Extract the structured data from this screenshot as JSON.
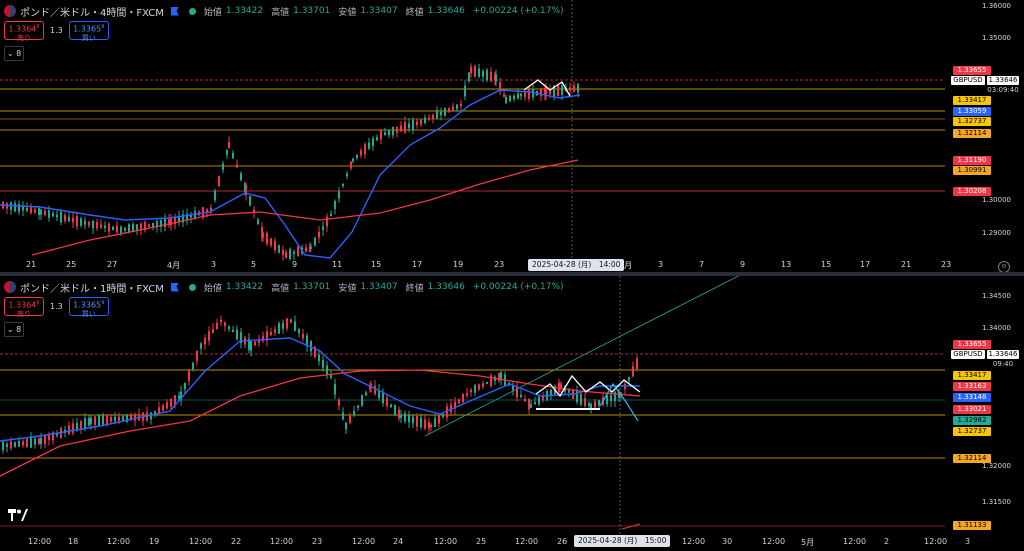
{
  "colors": {
    "bull": "#22ab94",
    "bear": "#f23645",
    "ma_blue": "#2962ff",
    "ma_red": "#f23645",
    "yellow": "#f7c600",
    "orange": "#f5a623"
  },
  "pane4h": {
    "title": "ポンド／米ドル・4時間・FXCM",
    "ohlc": [
      {
        "k": "始値",
        "v": "1.33422"
      },
      {
        "k": "高値",
        "v": "1.33701"
      },
      {
        "k": "安値",
        "v": "1.33407"
      },
      {
        "k": "終値",
        "v": "1.33646"
      },
      {
        "k": "",
        "v": "+0.00224 (+0.17%)"
      }
    ],
    "sell": {
      "price": "1.3364",
      "sup": "6",
      "label": "売り"
    },
    "buy": {
      "price": "1.3365",
      "sup": "9",
      "label": "買い"
    },
    "spread": "1.3",
    "collapse": "8",
    "axis_prices": [
      "1.36000",
      "1.35000",
      "1.30000",
      "1.29000"
    ],
    "labels": [
      "1.33655",
      "1.33417",
      "1.33059",
      "1.32737",
      "1.32114",
      "1.31190",
      "1.30991",
      "1.30208"
    ],
    "gbp": {
      "sym": "GBPUSD",
      "price": "1.33646",
      "countdown": "03:09:40"
    },
    "time_labels": [
      "21",
      "25",
      "27",
      "4月",
      "3",
      "5",
      "9",
      "11",
      "15",
      "17",
      "19",
      "23",
      "5月",
      "3",
      "7",
      "9",
      "13",
      "15",
      "17",
      "21",
      "23"
    ],
    "crosshair": "2025-04-28 (月)　14:00"
  },
  "pane1h": {
    "title": "ポンド／米ドル・1時間・FXCM",
    "ohlc": [
      {
        "k": "始値",
        "v": "1.33422"
      },
      {
        "k": "高値",
        "v": "1.33701"
      },
      {
        "k": "安値",
        "v": "1.33407"
      },
      {
        "k": "終値",
        "v": "1.33646"
      },
      {
        "k": "",
        "v": "+0.00224 (+0.17%)"
      }
    ],
    "sell": {
      "price": "1.3364",
      "sup": "6",
      "label": "売り"
    },
    "buy": {
      "price": "1.3365",
      "sup": "9",
      "label": "買い"
    },
    "spread": "1.3",
    "collapse": "8",
    "axis_prices": [
      "1.34500",
      "1.34000",
      "1.32000",
      "1.31500"
    ],
    "labels": [
      "1.33655",
      "1.33417",
      "1.33163",
      "1.33148",
      "1.33021",
      "1.32982",
      "1.32737",
      "1.32114",
      "1.31133"
    ],
    "gbp": {
      "sym": "GBPUSD",
      "price": "1.33646",
      "countdown": "09:40"
    },
    "time_labels": [
      "12:00",
      "18",
      "12:00",
      "19",
      "12:00",
      "22",
      "12:00",
      "23",
      "12:00",
      "24",
      "12:00",
      "25",
      "12:00",
      "26",
      "12:00",
      "30",
      "12:00",
      "5月",
      "12:00",
      "2",
      "12:00",
      "3"
    ],
    "crosshair": "2025-04-28 (月)　15:00"
  }
}
